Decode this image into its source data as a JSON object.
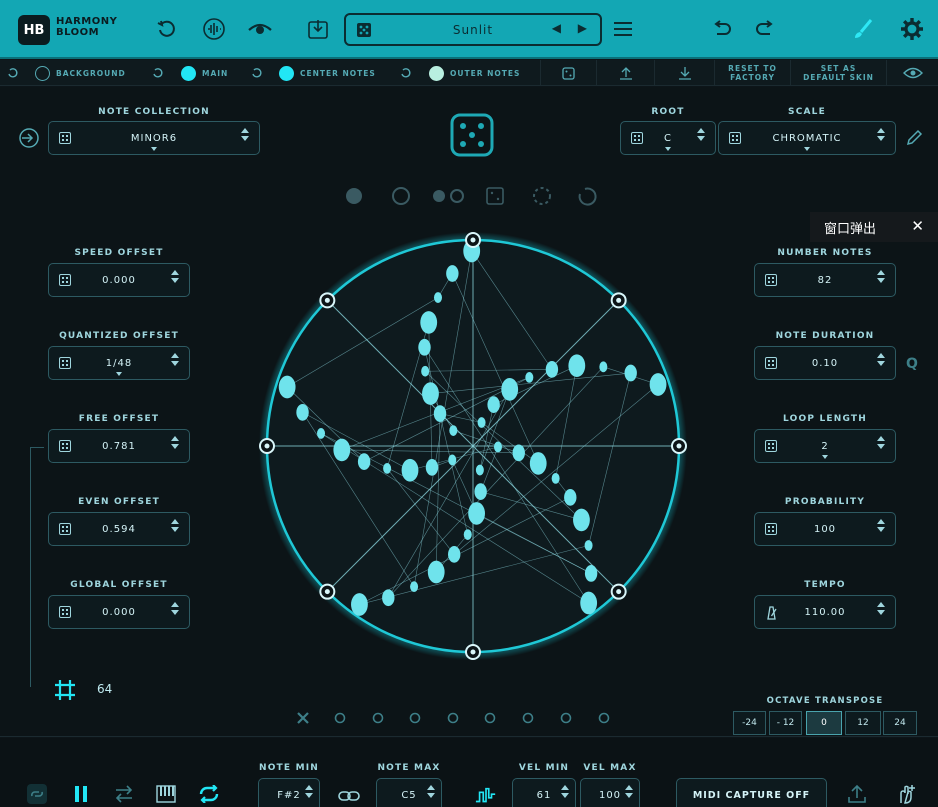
{
  "app": {
    "logo_mark": "HB",
    "logo_line1": "HARMONY",
    "logo_line2": "BLOOM"
  },
  "toolbar": {
    "preset_name": "Sunlit",
    "icons": [
      "reset-icon",
      "waveform-icon",
      "eye-closed-icon",
      "download-icon",
      "menu-icon",
      "undo-icon",
      "redo-icon",
      "brush-icon",
      "gear-icon"
    ]
  },
  "skinbar": {
    "background_label": "BACKGROUND",
    "main_label": "MAIN",
    "center_label": "CENTER NOTES",
    "outer_label": "OUTER NOTES",
    "reset_factory_l1": "RESET TO",
    "reset_factory_l2": "FACTORY",
    "default_skin_l1": "SET AS",
    "default_skin_l2": "DEFAULT SKIN",
    "colors": {
      "main": "#22e6f5",
      "center": "#22e6f5",
      "outer": "#b8efe0"
    }
  },
  "left": {
    "note_collection_label": "NOTE COLLECTION",
    "note_collection_value": "MINOR6",
    "speed_label": "SPEED OFFSET",
    "speed_value": "0.000",
    "quantized_label": "QUANTIZED OFFSET",
    "quantized_value": "1/48",
    "free_label": "FREE OFFSET",
    "free_value": "0.781",
    "even_label": "EVEN OFFSET",
    "even_value": "0.594",
    "global_label": "GLOBAL OFFSET",
    "global_value": "0.000",
    "grid_value": "64"
  },
  "right": {
    "root_label": "ROOT",
    "root_value": "C",
    "scale_label": "SCALE",
    "scale_value": "CHROMATIC",
    "number_notes_label": "NUMBER NOTES",
    "number_notes_value": "82",
    "note_duration_label": "NOTE DURATION",
    "note_duration_value": "0.10",
    "loop_length_label": "LOOP LENGTH",
    "loop_length_value": "2",
    "probability_label": "PROBABILITY",
    "probability_value": "100",
    "tempo_label": "TEMPO",
    "tempo_value": "110.00",
    "octave_label": "OCTAVE TRANSPOSE",
    "octaves": [
      "-24",
      "- 12",
      "0",
      "12",
      "24"
    ],
    "octave_selected": "0",
    "q_label": "Q"
  },
  "popup": {
    "text": "窗口弹出",
    "close": "✕"
  },
  "bottom": {
    "note_min_label": "NOTE MIN",
    "note_min_value": "F#2",
    "note_max_label": "NOTE MAX",
    "note_max_value": "C5",
    "vel_min_label": "VEL MIN",
    "vel_min_value": "61",
    "vel_max_label": "VEL MAX",
    "vel_max_value": "100",
    "midi_capture_label": "MIDI CAPTURE OFF"
  }
}
